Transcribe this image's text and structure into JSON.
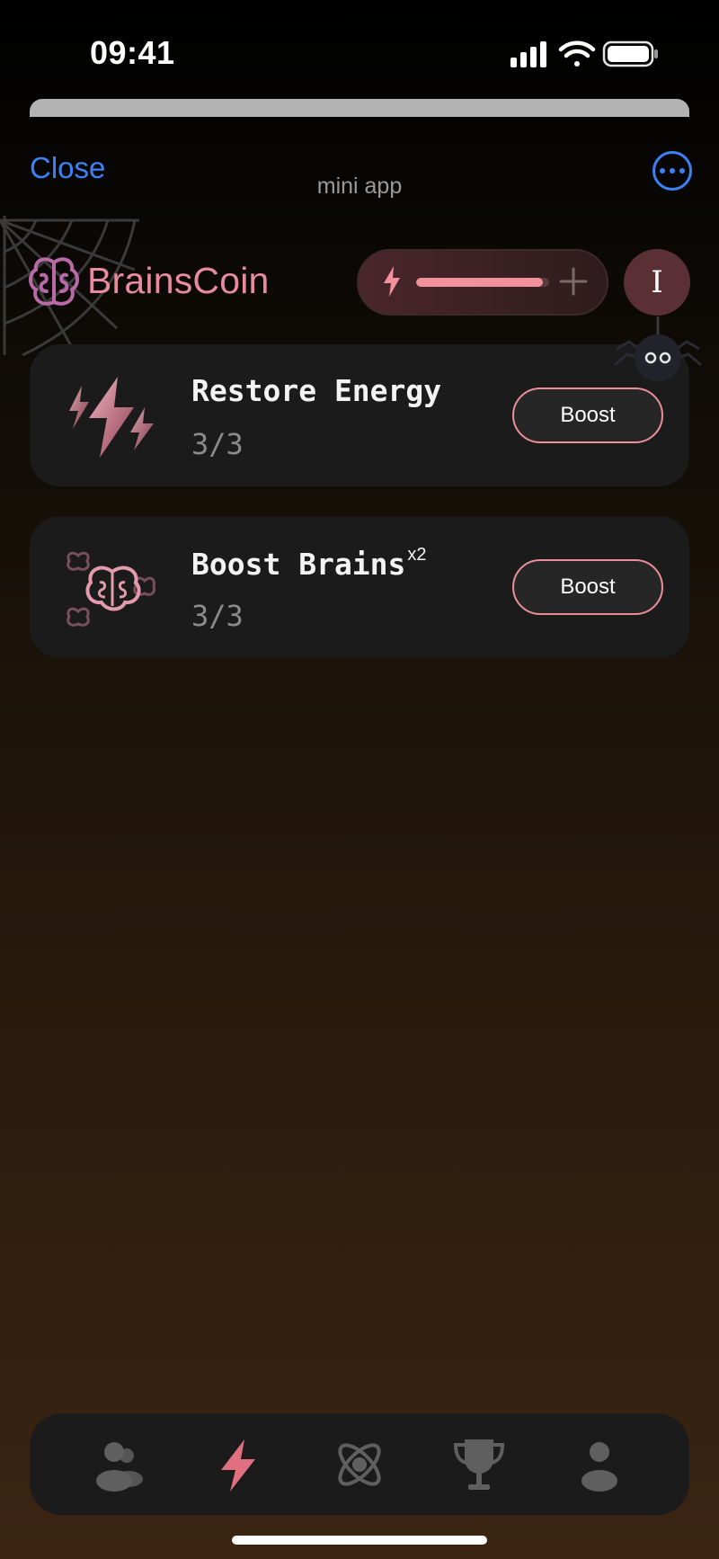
{
  "status_bar": {
    "time": "09:41"
  },
  "header": {
    "close_label": "Close",
    "subtitle": "mini app"
  },
  "brand": {
    "name": "BrainsCoin",
    "color": "#e88aa0"
  },
  "energy": {
    "level": 0.95,
    "accent": "#f0919c"
  },
  "avatar": {
    "initial": "I"
  },
  "boosts": [
    {
      "title": "Restore Energy",
      "superscript": "",
      "count": "3/3",
      "button_label": "Boost",
      "icon": "lightning-icon"
    },
    {
      "title": "Boost Brains",
      "superscript": "x2",
      "count": "3/3",
      "button_label": "Boost",
      "icon": "brains-icon"
    }
  ],
  "nav": {
    "items": [
      {
        "icon": "friends-icon",
        "active": false
      },
      {
        "icon": "boost-icon",
        "active": true
      },
      {
        "icon": "atom-icon",
        "active": false
      },
      {
        "icon": "trophy-icon",
        "active": false
      },
      {
        "icon": "profile-icon",
        "active": false
      }
    ],
    "active_color": "#e0707f",
    "inactive_color": "#5f5f5f"
  }
}
